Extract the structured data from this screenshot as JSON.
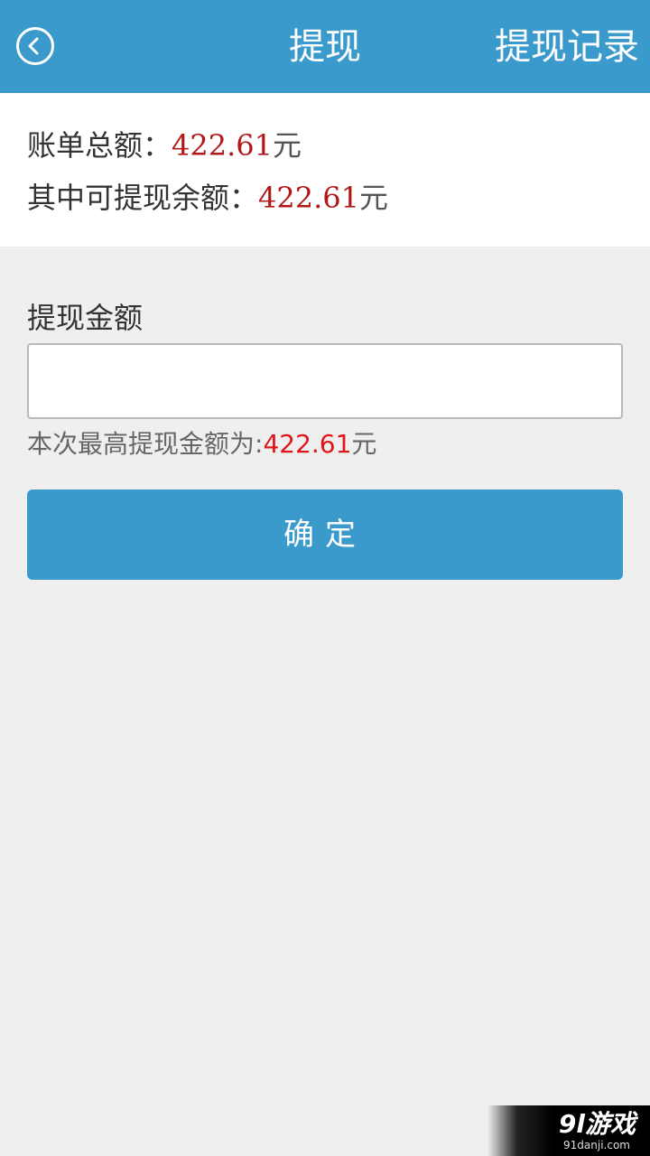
{
  "header": {
    "title": "提现",
    "right_action": "提现记录",
    "back_icon": "chevron-left-circle-icon",
    "background": "#3a9acb"
  },
  "summary": {
    "total_label": "账单总额：",
    "total_amount": "422.61",
    "total_unit": "元",
    "withdrawable_label": "其中可提现余额：",
    "withdrawable_amount": "422.61",
    "withdrawable_unit": "元",
    "amount_color": "#b01818"
  },
  "form": {
    "amount_label": "提现金额",
    "amount_value": "",
    "max_hint_label": "本次最高提现金额为:",
    "max_hint_amount": "422.61",
    "max_hint_unit": "元",
    "hint_amount_color": "#e0141b",
    "confirm_label": "确定"
  },
  "watermark": {
    "main": "9l游戏",
    "sub": "91danji.com"
  }
}
